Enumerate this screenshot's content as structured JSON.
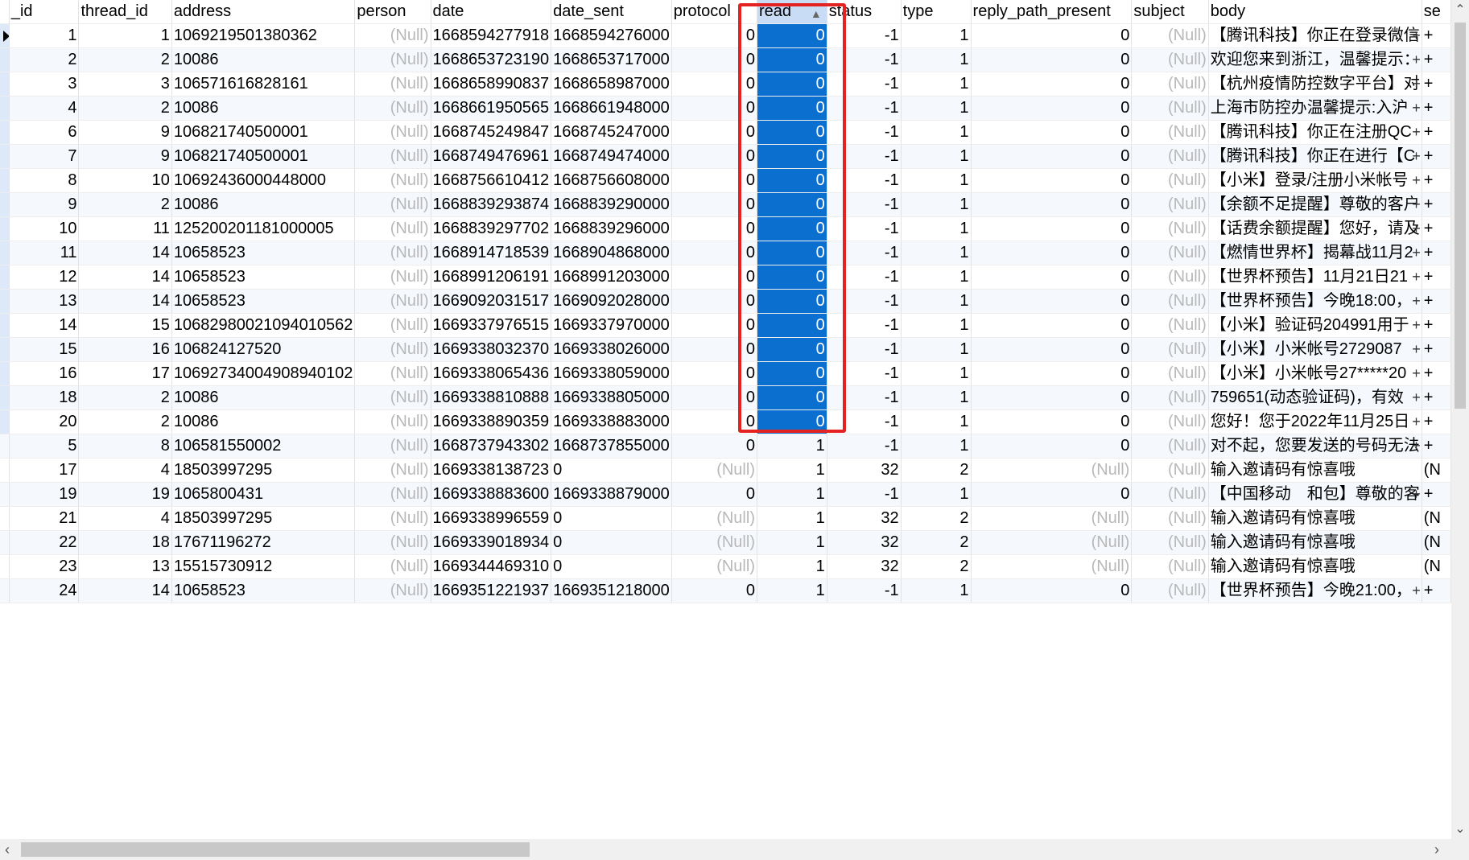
{
  "columns": [
    "_id",
    "thread_id",
    "address",
    "person",
    "date",
    "date_sent",
    "protocol",
    "read",
    "status",
    "type",
    "reply_path_present",
    "subject",
    "body",
    "se"
  ],
  "rows": [
    {
      "_id": "1",
      "thread_id": "1",
      "address": "1069219501380362",
      "person": "(Null)",
      "date": "1668594277918",
      "date_sent": "1668594276000",
      "protocol": "0",
      "read": "0",
      "status": "-1",
      "type": "1",
      "reply_path_present": "0",
      "subject": "(Null)",
      "body": "【腾讯科技】你正在登录微信",
      "se": "+"
    },
    {
      "_id": "2",
      "thread_id": "2",
      "address": "10086",
      "person": "(Null)",
      "date": "1668653723190",
      "date_sent": "1668653717000",
      "protocol": "0",
      "read": "0",
      "status": "-1",
      "type": "1",
      "reply_path_present": "0",
      "subject": "(Null)",
      "body": "欢迎您来到浙江，温馨提示：",
      "se": "+"
    },
    {
      "_id": "3",
      "thread_id": "3",
      "address": "106571616828161",
      "person": "(Null)",
      "date": "1668658990837",
      "date_sent": "1668658987000",
      "protocol": "0",
      "read": "0",
      "status": "-1",
      "type": "1",
      "reply_path_present": "0",
      "subject": "(Null)",
      "body": "【杭州疫情防控数字平台】对",
      "se": "+"
    },
    {
      "_id": "4",
      "thread_id": "2",
      "address": "10086",
      "person": "(Null)",
      "date": "1668661950565",
      "date_sent": "1668661948000",
      "protocol": "0",
      "read": "0",
      "status": "-1",
      "type": "1",
      "reply_path_present": "0",
      "subject": "(Null)",
      "body": "上海市防控办温馨提示:入沪",
      "se": "+"
    },
    {
      "_id": "6",
      "thread_id": "9",
      "address": "106821740500001",
      "person": "(Null)",
      "date": "1668745249847",
      "date_sent": "1668745247000",
      "protocol": "0",
      "read": "0",
      "status": "-1",
      "type": "1",
      "reply_path_present": "0",
      "subject": "(Null)",
      "body": "【腾讯科技】你正在注册QC",
      "se": "+"
    },
    {
      "_id": "7",
      "thread_id": "9",
      "address": "106821740500001",
      "person": "(Null)",
      "date": "1668749476961",
      "date_sent": "1668749474000",
      "protocol": "0",
      "read": "0",
      "status": "-1",
      "type": "1",
      "reply_path_present": "0",
      "subject": "(Null)",
      "body": "【腾讯科技】你正在进行【C",
      "se": "+"
    },
    {
      "_id": "8",
      "thread_id": "10",
      "address": "10692436000448000",
      "person": "(Null)",
      "date": "1668756610412",
      "date_sent": "1668756608000",
      "protocol": "0",
      "read": "0",
      "status": "-1",
      "type": "1",
      "reply_path_present": "0",
      "subject": "(Null)",
      "body": "【小米】登录/注册小米帐号",
      "se": "+"
    },
    {
      "_id": "9",
      "thread_id": "2",
      "address": "10086",
      "person": "(Null)",
      "date": "1668839293874",
      "date_sent": "1668839290000",
      "protocol": "0",
      "read": "0",
      "status": "-1",
      "type": "1",
      "reply_path_present": "0",
      "subject": "(Null)",
      "body": "【余额不足提醒】尊敬的客户",
      "se": "+"
    },
    {
      "_id": "10",
      "thread_id": "11",
      "address": "125200201181000005",
      "person": "(Null)",
      "date": "1668839297702",
      "date_sent": "1668839296000",
      "protocol": "0",
      "read": "0",
      "status": "-1",
      "type": "1",
      "reply_path_present": "0",
      "subject": "(Null)",
      "body": "【话费余额提醒】您好，请及",
      "se": "+"
    },
    {
      "_id": "11",
      "thread_id": "14",
      "address": "10658523",
      "person": "(Null)",
      "date": "1668914718539",
      "date_sent": "1668904868000",
      "protocol": "0",
      "read": "0",
      "status": "-1",
      "type": "1",
      "reply_path_present": "0",
      "subject": "(Null)",
      "body": "【燃情世界杯】揭幕战11月2",
      "se": "+"
    },
    {
      "_id": "12",
      "thread_id": "14",
      "address": "10658523",
      "person": "(Null)",
      "date": "1668991206191",
      "date_sent": "1668991203000",
      "protocol": "0",
      "read": "0",
      "status": "-1",
      "type": "1",
      "reply_path_present": "0",
      "subject": "(Null)",
      "body": "【世界杯预告】11月21日21",
      "se": "+"
    },
    {
      "_id": "13",
      "thread_id": "14",
      "address": "10658523",
      "person": "(Null)",
      "date": "1669092031517",
      "date_sent": "1669092028000",
      "protocol": "0",
      "read": "0",
      "status": "-1",
      "type": "1",
      "reply_path_present": "0",
      "subject": "(Null)",
      "body": "【世界杯预告】今晚18:00，",
      "se": "+"
    },
    {
      "_id": "14",
      "thread_id": "15",
      "address": "10682980021094010562",
      "person": "(Null)",
      "date": "1669337976515",
      "date_sent": "1669337970000",
      "protocol": "0",
      "read": "0",
      "status": "-1",
      "type": "1",
      "reply_path_present": "0",
      "subject": "(Null)",
      "body": "【小米】验证码204991用于",
      "se": "+"
    },
    {
      "_id": "15",
      "thread_id": "16",
      "address": "106824127520",
      "person": "(Null)",
      "date": "1669338032370",
      "date_sent": "1669338026000",
      "protocol": "0",
      "read": "0",
      "status": "-1",
      "type": "1",
      "reply_path_present": "0",
      "subject": "(Null)",
      "body": "【小米】小米帐号2729087",
      "se": "+"
    },
    {
      "_id": "16",
      "thread_id": "17",
      "address": "10692734004908940102",
      "person": "(Null)",
      "date": "1669338065436",
      "date_sent": "1669338059000",
      "protocol": "0",
      "read": "0",
      "status": "-1",
      "type": "1",
      "reply_path_present": "0",
      "subject": "(Null)",
      "body": "【小米】小米帐号27*****20",
      "se": "+"
    },
    {
      "_id": "18",
      "thread_id": "2",
      "address": "10086",
      "person": "(Null)",
      "date": "1669338810888",
      "date_sent": "1669338805000",
      "protocol": "0",
      "read": "0",
      "status": "-1",
      "type": "1",
      "reply_path_present": "0",
      "subject": "(Null)",
      "body": "759651(动态验证码)，有效",
      "se": "+"
    },
    {
      "_id": "20",
      "thread_id": "2",
      "address": "10086",
      "person": "(Null)",
      "date": "1669338890359",
      "date_sent": "1669338883000",
      "protocol": "0",
      "read": "0",
      "status": "-1",
      "type": "1",
      "reply_path_present": "0",
      "subject": "(Null)",
      "body": "您好！您于2022年11月25日",
      "se": "+"
    },
    {
      "_id": "5",
      "thread_id": "8",
      "address": "106581550002",
      "person": "(Null)",
      "date": "1668737943302",
      "date_sent": "1668737855000",
      "protocol": "0",
      "read": "1",
      "status": "-1",
      "type": "1",
      "reply_path_present": "0",
      "subject": "(Null)",
      "body": "对不起，您要发送的号码无法",
      "se": "+"
    },
    {
      "_id": "17",
      "thread_id": "4",
      "address": "18503997295",
      "person": "(Null)",
      "date": "1669338138723",
      "date_sent": "0",
      "protocol": "(Null)",
      "read": "1",
      "status": "32",
      "type": "2",
      "reply_path_present": "(Null)",
      "subject": "(Null)",
      "body": "输入邀请码有惊喜哦",
      "se": "(N"
    },
    {
      "_id": "19",
      "thread_id": "19",
      "address": "1065800431",
      "person": "(Null)",
      "date": "1669338883600",
      "date_sent": "1669338879000",
      "protocol": "0",
      "read": "1",
      "status": "-1",
      "type": "1",
      "reply_path_present": "0",
      "subject": "(Null)",
      "body": "【中国移动　和包】尊敬的客",
      "se": "+"
    },
    {
      "_id": "21",
      "thread_id": "4",
      "address": "18503997295",
      "person": "(Null)",
      "date": "1669338996559",
      "date_sent": "0",
      "protocol": "(Null)",
      "read": "1",
      "status": "32",
      "type": "2",
      "reply_path_present": "(Null)",
      "subject": "(Null)",
      "body": "输入邀请码有惊喜哦",
      "se": "(N"
    },
    {
      "_id": "22",
      "thread_id": "18",
      "address": "17671196272",
      "person": "(Null)",
      "date": "1669339018934",
      "date_sent": "0",
      "protocol": "(Null)",
      "read": "1",
      "status": "32",
      "type": "2",
      "reply_path_present": "(Null)",
      "subject": "(Null)",
      "body": "输入邀请码有惊喜哦",
      "se": "(N"
    },
    {
      "_id": "23",
      "thread_id": "13",
      "address": "15515730912",
      "person": "(Null)",
      "date": "1669344469310",
      "date_sent": "0",
      "protocol": "(Null)",
      "read": "1",
      "status": "32",
      "type": "2",
      "reply_path_present": "(Null)",
      "subject": "(Null)",
      "body": "输入邀请码有惊喜哦",
      "se": "(N"
    },
    {
      "_id": "24",
      "thread_id": "14",
      "address": "10658523",
      "person": "(Null)",
      "date": "1669351221937",
      "date_sent": "1669351218000",
      "protocol": "0",
      "read": "1",
      "status": "-1",
      "type": "1",
      "reply_path_present": "0",
      "subject": "(Null)",
      "body": "【世界杯预告】今晚21:00，",
      "se": "+"
    }
  ],
  "selected_rows_count": 17,
  "selection_color": "#0b6fd0",
  "highlight_color": "#e52222",
  "sort_column": "read",
  "scrollbars": {
    "up_arrow": "up-arrow-icon",
    "down_arrow": "down-arrow-icon",
    "left_arrow": "left-arrow-icon",
    "right_arrow": "right-arrow-icon"
  }
}
